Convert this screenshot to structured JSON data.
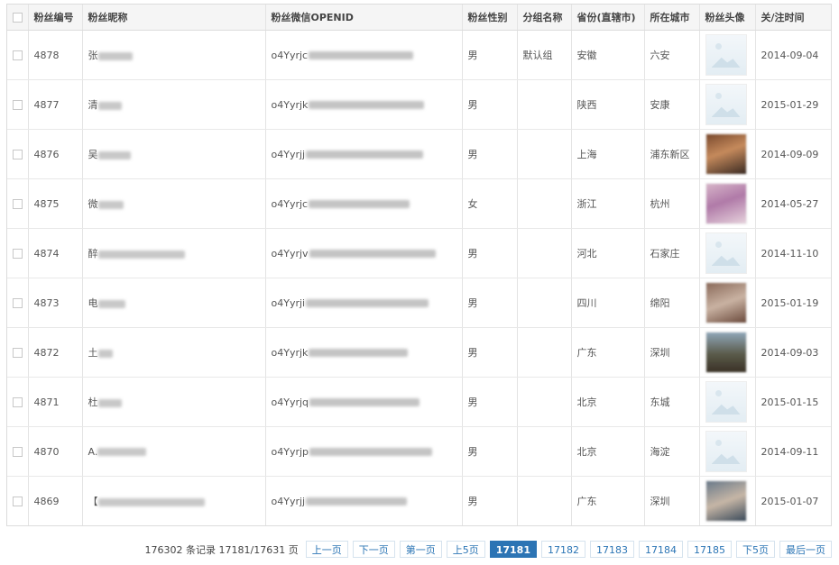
{
  "table": {
    "headers": [
      "粉丝编号",
      "粉丝昵称",
      "粉丝微信OPENID",
      "粉丝性别",
      "分组名称",
      "省份(直辖市)",
      "所在城市",
      "粉丝头像",
      "关/注时间"
    ],
    "rows": [
      {
        "id": "4878",
        "nickname": "张",
        "openid": "o4Yyrjc",
        "gender": "男",
        "group": "默认组",
        "province": "安徽",
        "city": "六安",
        "avatar": "default",
        "time": "2014-09-04"
      },
      {
        "id": "4877",
        "nickname": "清",
        "openid": "o4Yyrjk",
        "gender": "男",
        "group": "",
        "province": "陕西",
        "city": "安康",
        "avatar": "default",
        "time": "2015-01-29"
      },
      {
        "id": "4876",
        "nickname": "吴",
        "openid": "o4Yyrjj",
        "gender": "男",
        "group": "",
        "province": "上海",
        "city": "浦东新区",
        "avatar": "photo",
        "time": "2014-09-09"
      },
      {
        "id": "4875",
        "nickname": "微",
        "openid": "o4Yyrjc",
        "gender": "女",
        "group": "",
        "province": "浙江",
        "city": "杭州",
        "avatar": "photo",
        "time": "2014-05-27"
      },
      {
        "id": "4874",
        "nickname": "醉",
        "openid": "o4Yyrjv",
        "gender": "男",
        "group": "",
        "province": "河北",
        "city": "石家庄",
        "avatar": "default",
        "time": "2014-11-10"
      },
      {
        "id": "4873",
        "nickname": "电",
        "openid": "o4Yyrji",
        "gender": "男",
        "group": "",
        "province": "四川",
        "city": "绵阳",
        "avatar": "photo",
        "time": "2015-01-19"
      },
      {
        "id": "4872",
        "nickname": "土",
        "openid": "o4Yyrjk",
        "gender": "男",
        "group": "",
        "province": "广东",
        "city": "深圳",
        "avatar": "photo",
        "time": "2014-09-03"
      },
      {
        "id": "4871",
        "nickname": "杜",
        "openid": "o4Yyrjq",
        "gender": "男",
        "group": "",
        "province": "北京",
        "city": "东城",
        "avatar": "default",
        "time": "2015-01-15"
      },
      {
        "id": "4870",
        "nickname": "A.",
        "openid": "o4Yyrjp",
        "gender": "男",
        "group": "",
        "province": "北京",
        "city": "海淀",
        "avatar": "default",
        "time": "2014-09-11"
      },
      {
        "id": "4869",
        "nickname": "【",
        "openid": "o4Yyrjj",
        "gender": "男",
        "group": "",
        "province": "广东",
        "city": "深圳",
        "avatar": "photo",
        "time": "2015-01-07"
      }
    ]
  },
  "pagination": {
    "summary": "176302 条记录 17181/17631 页",
    "prev": "上一页",
    "next": "下一页",
    "first": "第一页",
    "prev5": "上5页",
    "pages": [
      "17181",
      "17182",
      "17183",
      "17184",
      "17185"
    ],
    "current_page": "17181",
    "next5": "下5页",
    "last": "最后一页"
  },
  "colors": {
    "accent": "#2c74b4",
    "link": "#2b75b5",
    "header_bg": "#f5f5f5",
    "border": "#dcdcdc"
  }
}
